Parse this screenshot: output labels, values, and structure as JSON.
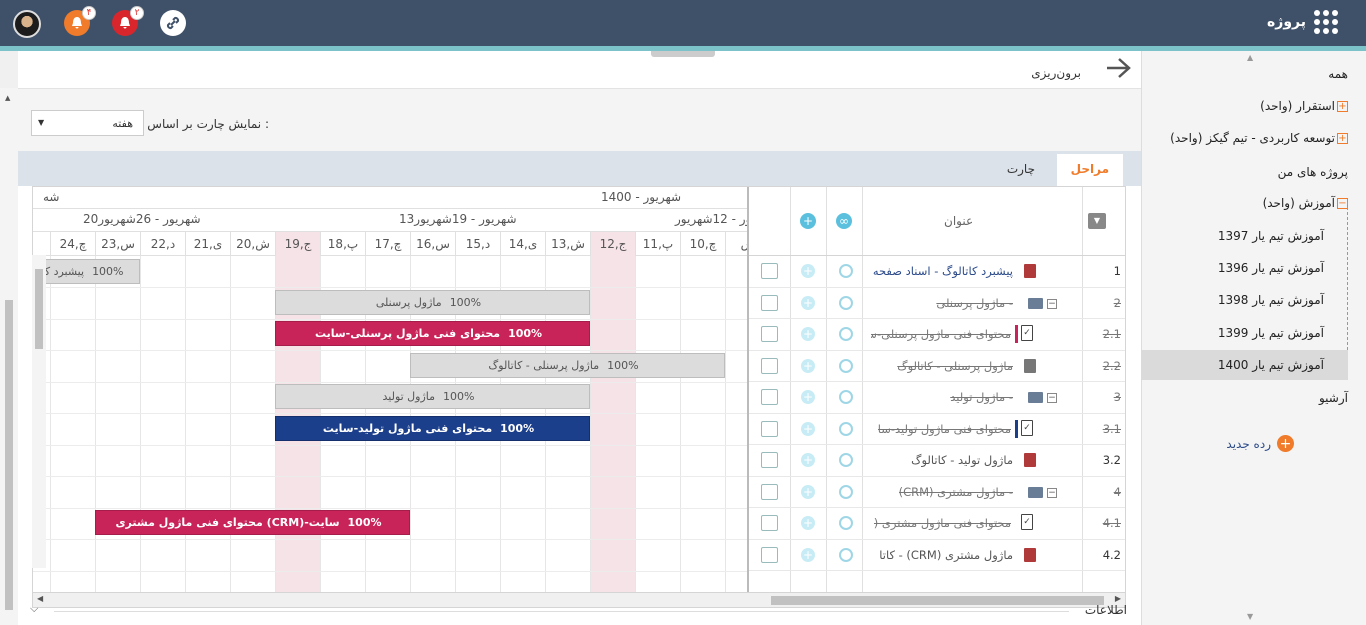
{
  "app": {
    "name": "پروژه",
    "notif_badge_1": "۴",
    "notif_badge_2": "۲"
  },
  "sidebar": {
    "items": [
      {
        "label": "همه"
      },
      {
        "label": "استقرار (واحد)"
      },
      {
        "label": "توسعه کاربردی - تیم گیکز (واحد)"
      },
      {
        "label": "پروژه های من"
      },
      {
        "label": "آموزش (واحد)"
      }
    ],
    "sub_items": [
      {
        "label": "آموزش تیم یار 1397"
      },
      {
        "label": "آموزش تیم یار 1396"
      },
      {
        "label": "آموزش تیم یار 1398"
      },
      {
        "label": "آموزش تیم یار 1399"
      },
      {
        "label": "آموزش تیم یار 1400"
      }
    ],
    "archive": "آرشیو",
    "new_row": "رده جدید"
  },
  "header": {
    "title": "برون‌ریزی"
  },
  "toolbar": {
    "label": "نمایش چارت بر اساس :",
    "select_value": "هفته"
  },
  "tabs": {
    "active": "مراحل",
    "other": "چارت"
  },
  "gantt": {
    "month1": "شهریور - 1400",
    "month_edge": "شه",
    "weeks": [
      "20شهریور - 26شهریور",
      "13شهریور - 19شهریور",
      "ریور - 12شهریور"
    ],
    "days": [
      "چ,24",
      "س,23",
      "د,22",
      "ی,21",
      "ش,20",
      "ج,19",
      "پ,18",
      "چ,17",
      "س,16",
      "د,15",
      "ی,14",
      "ش,13",
      "ج,12",
      "پ,11",
      "چ,10",
      "س"
    ],
    "bars": [
      {
        "pct": "100%",
        "label": "پیشبرد کا"
      },
      {
        "pct": "100%",
        "label": "ماژول پرسنلی"
      },
      {
        "pct": "100%",
        "label": "محتوای فنی ماژول پرسنلی-سایت"
      },
      {
        "pct": "100%",
        "label": "ماژول پرسنلی - کاتالوگ"
      },
      {
        "pct": "100%",
        "label": "ماژول تولید"
      },
      {
        "pct": "100%",
        "label": "محتوای فنی ماژول تولید-سایت"
      },
      {
        "pct": "100%",
        "label": "محتوای فنی ماژول مشتری (CRM)-سایت"
      }
    ]
  },
  "table": {
    "title_header": "عنوان",
    "rows": [
      {
        "num": "1",
        "name": "پیشبرد کاتالوگ - اسناد صفحه ا"
      },
      {
        "num": "2",
        "name": "- ماژول پرسنلی"
      },
      {
        "num": "2.1",
        "name": "محتوای فنی ماژول پرسنلی-س"
      },
      {
        "num": "2.2",
        "name": "ماژول پرسنلی - کاتالوگ"
      },
      {
        "num": "3",
        "name": "- ماژول تولید"
      },
      {
        "num": "3.1",
        "name": "محتوای فنی ماژول تولید-سا"
      },
      {
        "num": "3.2",
        "name": "ماژول تولید - کاتالوگ"
      },
      {
        "num": "4",
        "name": "- ماژول مشتری (CRM)"
      },
      {
        "num": "4.1",
        "name": "محتوای فنی ماژول مشتری ("
      },
      {
        "num": "4.2",
        "name": "ماژول مشتری (CRM) - کاتا"
      }
    ]
  },
  "footer": {
    "info": "اطلاعات"
  }
}
